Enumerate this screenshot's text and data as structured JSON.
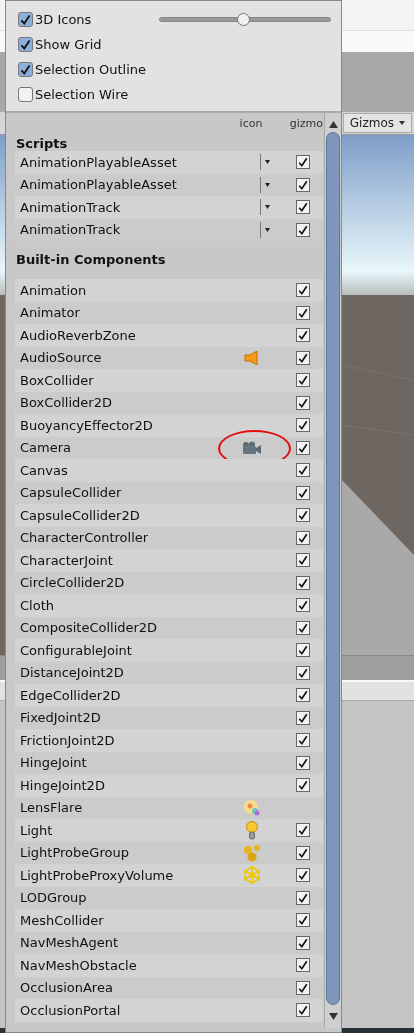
{
  "options": [
    {
      "label": "3D Icons",
      "checked": true,
      "slider": {
        "level": 0.49
      }
    },
    {
      "label": "Show Grid",
      "checked": true
    },
    {
      "label": "Selection Outline",
      "checked": true
    },
    {
      "label": "Selection Wire",
      "checked": false
    }
  ],
  "columns": [
    "icon",
    "gizmo"
  ],
  "sections": [
    {
      "title": "Scripts",
      "items": [
        {
          "name": "AnimationPlayableAsset",
          "kind": "script",
          "has_gizmo": true,
          "checked": true
        },
        {
          "name": "AnimationPlayableAsset",
          "kind": "script",
          "has_gizmo": true,
          "checked": true
        },
        {
          "name": "AnimationTrack",
          "kind": "script",
          "has_gizmo": true,
          "checked": true
        },
        {
          "name": "AnimationTrack",
          "kind": "script",
          "has_gizmo": true,
          "checked": true
        }
      ]
    },
    {
      "title": "Built-in Components",
      "items": [
        {
          "name": "Animation",
          "kind": "plain",
          "has_gizmo": true,
          "checked": true
        },
        {
          "name": "Animator",
          "kind": "plain",
          "has_gizmo": true,
          "checked": true
        },
        {
          "name": "AudioReverbZone",
          "kind": "plain",
          "has_gizmo": true,
          "checked": true
        },
        {
          "name": "AudioSource",
          "kind": "speaker",
          "has_gizmo": true,
          "checked": true
        },
        {
          "name": "BoxCollider",
          "kind": "plain",
          "has_gizmo": true,
          "checked": true
        },
        {
          "name": "BoxCollider2D",
          "kind": "plain",
          "has_gizmo": true,
          "checked": true
        },
        {
          "name": "BuoyancyEffector2D",
          "kind": "plain",
          "has_gizmo": true,
          "checked": true
        },
        {
          "name": "Camera",
          "kind": "camera",
          "has_gizmo": true,
          "checked": true,
          "highlight": true
        },
        {
          "name": "Canvas",
          "kind": "plain",
          "has_gizmo": true,
          "checked": true
        },
        {
          "name": "CapsuleCollider",
          "kind": "plain",
          "has_gizmo": true,
          "checked": true
        },
        {
          "name": "CapsuleCollider2D",
          "kind": "plain",
          "has_gizmo": true,
          "checked": true
        },
        {
          "name": "CharacterController",
          "kind": "plain",
          "has_gizmo": true,
          "checked": true
        },
        {
          "name": "CharacterJoint",
          "kind": "plain",
          "has_gizmo": true,
          "checked": true
        },
        {
          "name": "CircleCollider2D",
          "kind": "plain",
          "has_gizmo": true,
          "checked": true
        },
        {
          "name": "Cloth",
          "kind": "plain",
          "has_gizmo": true,
          "checked": true
        },
        {
          "name": "CompositeCollider2D",
          "kind": "plain",
          "has_gizmo": true,
          "checked": true
        },
        {
          "name": "ConfigurableJoint",
          "kind": "plain",
          "has_gizmo": true,
          "checked": true
        },
        {
          "name": "DistanceJoint2D",
          "kind": "plain",
          "has_gizmo": true,
          "checked": true
        },
        {
          "name": "EdgeCollider2D",
          "kind": "plain",
          "has_gizmo": true,
          "checked": true
        },
        {
          "name": "FixedJoint2D",
          "kind": "plain",
          "has_gizmo": true,
          "checked": true
        },
        {
          "name": "FrictionJoint2D",
          "kind": "plain",
          "has_gizmo": true,
          "checked": true
        },
        {
          "name": "HingeJoint",
          "kind": "plain",
          "has_gizmo": true,
          "checked": true
        },
        {
          "name": "HingeJoint2D",
          "kind": "plain",
          "has_gizmo": true,
          "checked": true
        },
        {
          "name": "LensFlare",
          "kind": "flare",
          "has_gizmo": false
        },
        {
          "name": "Light",
          "kind": "bulb",
          "has_gizmo": true,
          "checked": true
        },
        {
          "name": "LightProbeGroup",
          "kind": "spheres",
          "has_gizmo": true,
          "checked": true
        },
        {
          "name": "LightProbeProxyVolume",
          "kind": "network",
          "has_gizmo": true,
          "checked": true
        },
        {
          "name": "LODGroup",
          "kind": "plain",
          "has_gizmo": true,
          "checked": true
        },
        {
          "name": "MeshCollider",
          "kind": "plain",
          "has_gizmo": true,
          "checked": true
        },
        {
          "name": "NavMeshAgent",
          "kind": "plain",
          "has_gizmo": true,
          "checked": true
        },
        {
          "name": "NavMeshObstacle",
          "kind": "plain",
          "has_gizmo": true,
          "checked": true
        },
        {
          "name": "OcclusionArea",
          "kind": "plain",
          "has_gizmo": true,
          "checked": true
        },
        {
          "name": "OcclusionPortal",
          "kind": "plain",
          "has_gizmo": true,
          "checked": true
        }
      ]
    }
  ],
  "toolbar": {
    "gizmos_button": "Gizmos"
  }
}
